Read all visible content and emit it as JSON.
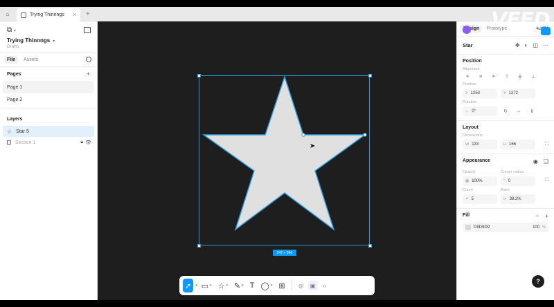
{
  "tabbar": {
    "tab_title": "Trying Thinnngs",
    "watermark": "VEED"
  },
  "left_panel": {
    "project_title": "Trying Thinnngs",
    "project_subtitle": "Drafts",
    "tabs": [
      {
        "label": "File"
      },
      {
        "label": "Assets"
      }
    ],
    "pages_title": "Pages",
    "pages": [
      {
        "label": "Page 1"
      },
      {
        "label": "Page 2"
      }
    ],
    "layers_title": "Layers",
    "layers": [
      {
        "label": "Star 5"
      },
      {
        "label": "Section 1"
      }
    ]
  },
  "canvas": {
    "dimension_label": "247 × 246",
    "star_fill": "#e0e0e0",
    "selection_color": "#2d9cdb"
  },
  "right_panel": {
    "tabs": [
      {
        "label": "Design"
      },
      {
        "label": "Prototype"
      }
    ],
    "zoom": "422%",
    "layer_name": "Star",
    "position_title": "Position",
    "alignment_label": "Alignment",
    "position_label": "Position",
    "x": "1253",
    "y": "1272",
    "rotation_label": "Rotation",
    "rotation": "0°",
    "layout_title": "Layout",
    "dimensions_label": "Dimensions",
    "w": "133",
    "h": "166",
    "appearance_title": "Appearance",
    "opacity_label": "Opacity",
    "opacity": "100%",
    "corner_label": "Corner radius",
    "corner": "0",
    "count_label": "Count",
    "count": "5",
    "ratio_label": "Ratio",
    "ratio": "38.2%",
    "fill_title": "Fill",
    "fill_hex": "D9D9D9",
    "fill_opacity": "100",
    "fill_pct": "%",
    "help": "?"
  }
}
